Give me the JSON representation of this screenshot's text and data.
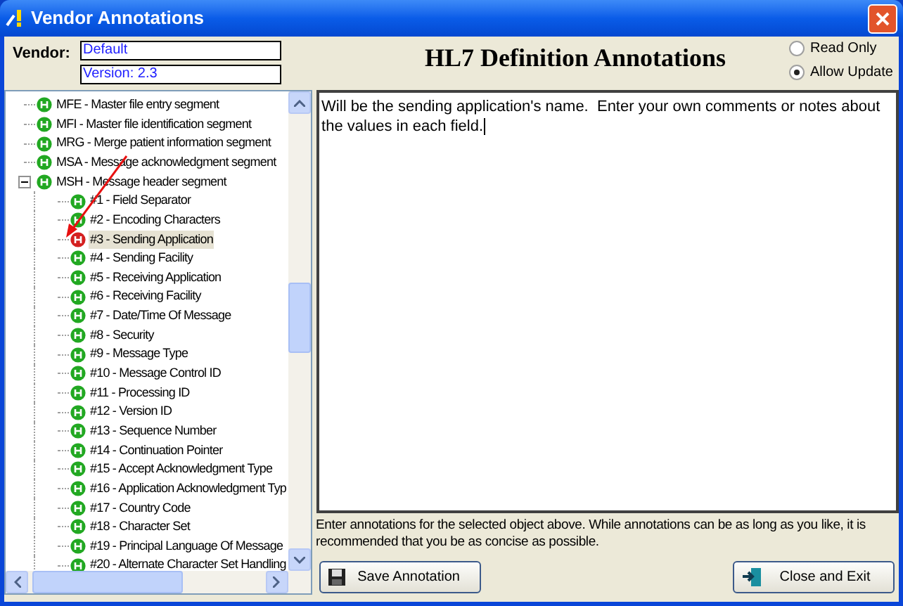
{
  "window": {
    "title": "Vendor Annotations"
  },
  "vendor": {
    "label": "Vendor:",
    "name": "Default",
    "version": "Version: 2.3"
  },
  "heading": "HL7 Definition Annotations",
  "mode": [
    {
      "label": "Read Only",
      "selected": false
    },
    {
      "label": "Allow Update",
      "selected": true
    }
  ],
  "tree": [
    {
      "label": "MFE - Master file entry segment",
      "selected": false
    },
    {
      "label": "MFI - Master file identification segment",
      "selected": false
    },
    {
      "label": "MRG - Merge patient information segment",
      "selected": false
    },
    {
      "label": "MSA - Message acknowledgment segment",
      "selected": false
    },
    {
      "label": "MSH - Message header segment",
      "selected": false,
      "expanded": true,
      "children": [
        {
          "label": "#1 - Field Separator",
          "selected": false
        },
        {
          "label": "#2 - Encoding Characters",
          "selected": false
        },
        {
          "label": "#3 - Sending Application",
          "selected": true
        },
        {
          "label": "#4 - Sending Facility",
          "selected": false
        },
        {
          "label": "#5 - Receiving Application",
          "selected": false
        },
        {
          "label": "#6 - Receiving Facility",
          "selected": false
        },
        {
          "label": "#7 - Date/Time Of Message",
          "selected": false
        },
        {
          "label": "#8 - Security",
          "selected": false
        },
        {
          "label": "#9 - Message Type",
          "selected": false
        },
        {
          "label": "#10 - Message Control ID",
          "selected": false
        },
        {
          "label": "#11 - Processing ID",
          "selected": false
        },
        {
          "label": "#12 - Version ID",
          "selected": false
        },
        {
          "label": "#13 - Sequence Number",
          "selected": false
        },
        {
          "label": "#14 - Continuation Pointer",
          "selected": false
        },
        {
          "label": "#15 - Accept Acknowledgment Type",
          "selected": false
        },
        {
          "label": "#16 - Application Acknowledgment Typ",
          "selected": false
        },
        {
          "label": "#17 - Country Code",
          "selected": false
        },
        {
          "label": "#18 - Character Set",
          "selected": false
        },
        {
          "label": "#19 - Principal Language Of Message",
          "selected": false
        },
        {
          "label": "#20 - Alternate Character Set Handling",
          "selected": false
        }
      ]
    }
  ],
  "annotation": {
    "value": "Will be the sending application's name.  Enter your own comments or notes about the values in each field."
  },
  "hint": "Enter annotations for the selected object above.  While annotations can be as long as you like, it is recommended that you be as concise as possible.",
  "buttons": [
    {
      "kind": "save",
      "label": "Save Annotation"
    },
    {
      "kind": "exit",
      "label": "Close and Exit"
    }
  ]
}
